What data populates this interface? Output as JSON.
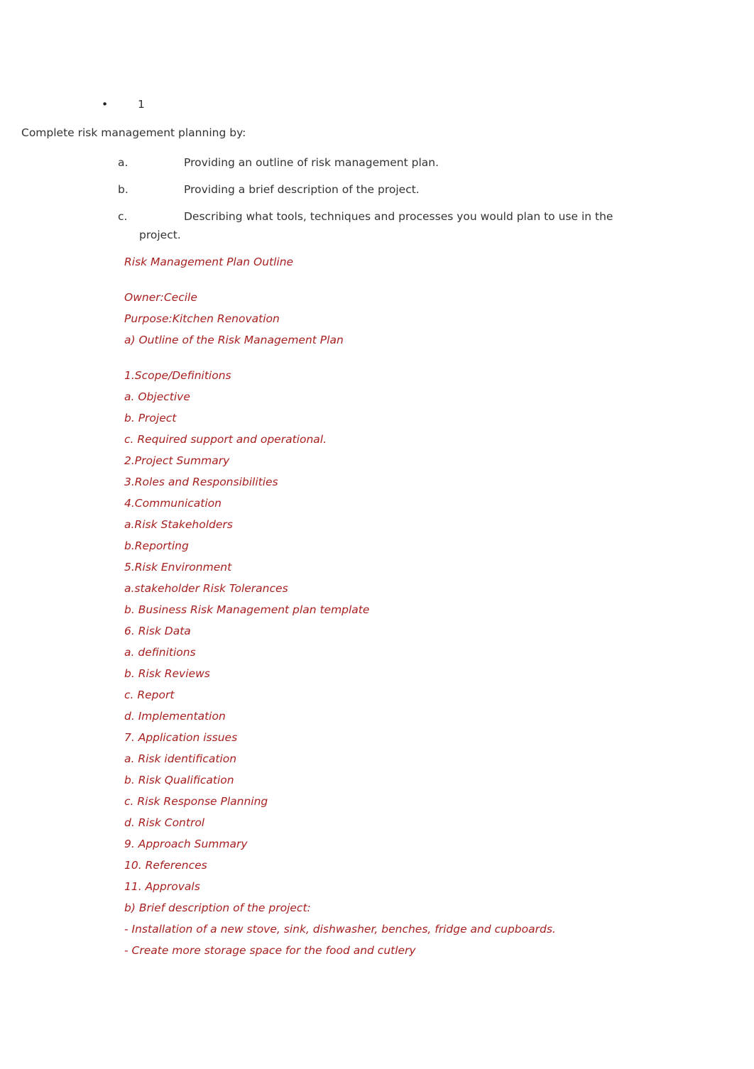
{
  "document": {
    "page_background": "#ffffff",
    "body_text_color": "#333333",
    "accent_color": "#A81F1F"
  },
  "question": {
    "bullet_glyph": "•",
    "number": "1",
    "lead_in": "Complete risk management planning by:",
    "sub_items": [
      {
        "marker": "a.",
        "text": "Providing an outline of risk management plan.",
        "wrap": ""
      },
      {
        "marker": "b.",
        "text": "Providing a brief description of the project.",
        "wrap": ""
      },
      {
        "marker": "c.",
        "text": "Describing what tools, techniques and processes you would plan to use in the",
        "wrap": "project."
      }
    ]
  },
  "answer": {
    "heading": "Risk Management Plan Outline",
    "owner_line": "Owner:Cecile",
    "purpose_line": "Purpose:Kitchen Renovation",
    "section_a_heading": "a) Outline of the Risk Management Plan",
    "outline_items": [
      "1.Scope/Definitions",
      "a. Objective",
      "b. Project",
      "c. Required support and operational.",
      "2.Project Summary",
      "3.Roles and Responsibilities",
      "4.Communication",
      "a.Risk Stakeholders",
      "b.Reporting",
      "5.Risk Environment",
      "a.stakeholder Risk Tolerances",
      "b. Business Risk Management plan template",
      "6. Risk Data",
      "a. definitions",
      "b. Risk Reviews",
      "c. Report",
      "d. Implementation",
      "7. Application issues",
      "a. Risk identification",
      "b. Risk Qualification",
      "c. Risk Response Planning",
      "d. Risk Control",
      "9. Approach Summary",
      "10. References",
      "11. Approvals"
    ],
    "section_b_heading": "b) Brief description of the project:",
    "project_description_bullets": [
      "- Installation of a new stove, sink, dishwasher, benches, fridge and cupboards.",
      "- Create more storage space for the food and cutlery"
    ]
  }
}
